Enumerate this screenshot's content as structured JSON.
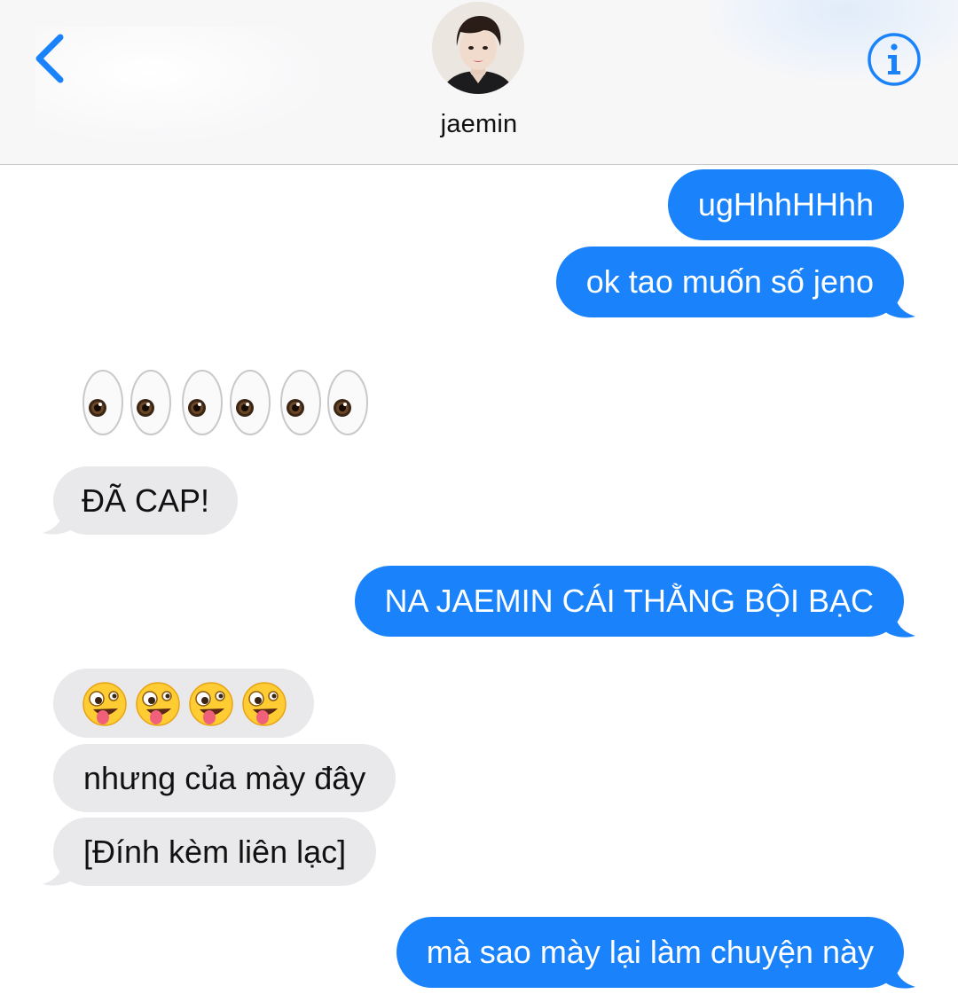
{
  "header": {
    "contact_name": "jaemin",
    "avatar_icon": "contact-photo",
    "back_icon": "chevron-left-icon",
    "info_icon": "info-icon",
    "accent_color": "#1a82fb"
  },
  "messages": [
    {
      "direction": "outgoing",
      "text": "ugHhhHHhh"
    },
    {
      "direction": "outgoing",
      "text": "ok tao muốn số jeno"
    },
    {
      "direction": "incoming",
      "type": "emoji",
      "emoji": "eyes",
      "count": 6
    },
    {
      "direction": "incoming",
      "text": "ĐÃ CAP!"
    },
    {
      "direction": "outgoing",
      "text": "NA JAEMIN CÁI THẰNG BỘI BẠC"
    },
    {
      "direction": "incoming",
      "type": "emoji",
      "emoji": "zany-face",
      "count": 4
    },
    {
      "direction": "incoming",
      "text": "nhưng của mày đây"
    },
    {
      "direction": "incoming",
      "text": "[Đính kèm liên lạc]"
    },
    {
      "direction": "outgoing",
      "text": "mà sao mày lại làm chuyện này"
    }
  ],
  "colors": {
    "outgoing_bubble": "#1a82fb",
    "incoming_bubble": "#e9e9eb",
    "header_bg": "#f7f7f8"
  }
}
